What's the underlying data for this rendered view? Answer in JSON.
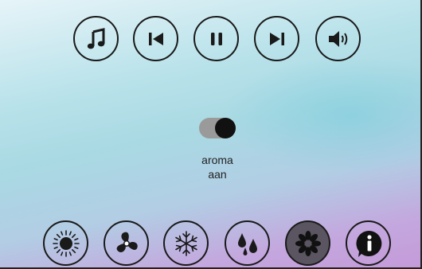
{
  "media_controls": [
    {
      "name": "music-button",
      "icon": "music-note-icon"
    },
    {
      "name": "previous-button",
      "icon": "skip-previous-icon"
    },
    {
      "name": "pause-button",
      "icon": "pause-icon"
    },
    {
      "name": "next-button",
      "icon": "skip-next-icon"
    },
    {
      "name": "volume-button",
      "icon": "volume-icon"
    }
  ],
  "aroma_toggle": {
    "state": "on",
    "label_line1": "aroma",
    "label_line2": "aan"
  },
  "bottom_bar": [
    {
      "name": "light-button",
      "icon": "sun-icon",
      "active": false
    },
    {
      "name": "fan-button",
      "icon": "fan-icon",
      "active": false
    },
    {
      "name": "cool-button",
      "icon": "snowflake-icon",
      "active": false
    },
    {
      "name": "water-button",
      "icon": "water-drops-icon",
      "active": false
    },
    {
      "name": "aroma-button",
      "icon": "flower-icon",
      "active": true
    },
    {
      "name": "info-button",
      "icon": "info-icon",
      "active": false
    }
  ],
  "colors": {
    "icon": "#1a1a1a",
    "active_background": "#5a5560",
    "toggle_track": "#9a9a9a"
  }
}
